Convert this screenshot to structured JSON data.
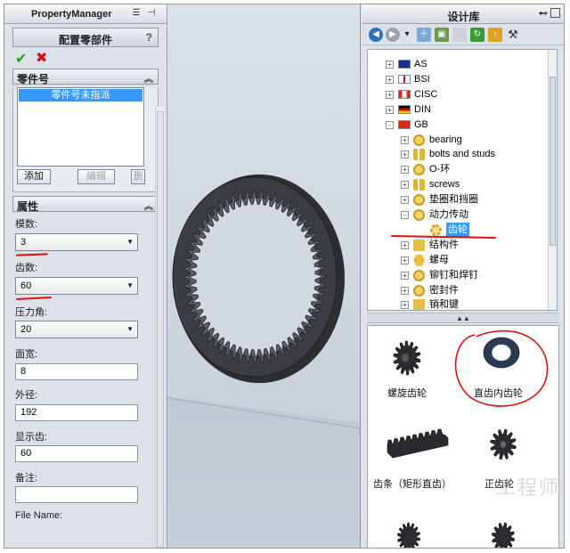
{
  "property_manager": {
    "title": "PropertyManager",
    "header": "配置零部件",
    "help": "?",
    "part_number_group": {
      "title": "零件号",
      "selected_item": "零件号未指派",
      "add_button": "添加",
      "edit_button": "编辑",
      "delete_button": "删"
    },
    "properties_group": {
      "title": "属性",
      "module_label": "模数:",
      "module_value": "3",
      "teeth_label": "齿数:",
      "teeth_value": "60",
      "pressure_angle_label": "压力角:",
      "pressure_angle_value": "20",
      "face_width_label": "面宽:",
      "face_width_value": "8",
      "outer_dia_label": "外径:",
      "outer_dia_value": "192",
      "display_teeth_label": "显示齿:",
      "display_teeth_value": "60",
      "notes_label": "备注:",
      "notes_value": "",
      "file_name_label": "File Name:"
    }
  },
  "design_library": {
    "title": "设计库",
    "tree": [
      {
        "label": "AS",
        "level": 1,
        "expander": "+",
        "icon": "australia-flag-icon"
      },
      {
        "label": "BSI",
        "level": 1,
        "expander": "+",
        "icon": "uk-flag-icon"
      },
      {
        "label": "CISC",
        "level": 1,
        "expander": "+",
        "icon": "canada-flag-icon"
      },
      {
        "label": "DIN",
        "level": 1,
        "expander": "+",
        "icon": "germany-flag-icon"
      },
      {
        "label": "GB",
        "level": 1,
        "expander": "-",
        "icon": "china-flag-icon"
      },
      {
        "label": "bearing",
        "level": 2,
        "expander": "+",
        "icon": "bearing-icon"
      },
      {
        "label": "bolts and studs",
        "level": 2,
        "expander": "+",
        "icon": "bolt-icon"
      },
      {
        "label": "O-环",
        "level": 2,
        "expander": "+",
        "icon": "o-ring-icon"
      },
      {
        "label": "screws",
        "level": 2,
        "expander": "+",
        "icon": "screw-icon"
      },
      {
        "label": "垫圈和挡圈",
        "level": 2,
        "expander": "+",
        "icon": "washer-icon"
      },
      {
        "label": "动力传动",
        "level": 2,
        "expander": "-",
        "icon": "power-transmission-icon"
      },
      {
        "label": "齿轮",
        "level": 3,
        "expander": "",
        "icon": "gear-icon",
        "selected": true
      },
      {
        "label": "结构件",
        "level": 2,
        "expander": "+",
        "icon": "structure-icon"
      },
      {
        "label": "螺母",
        "level": 2,
        "expander": "+",
        "icon": "nut-icon"
      },
      {
        "label": "铆钉和焊钉",
        "level": 2,
        "expander": "+",
        "icon": "rivet-icon"
      },
      {
        "label": "密封件",
        "level": 2,
        "expander": "+",
        "icon": "seal-icon"
      },
      {
        "label": "销和键",
        "level": 2,
        "expander": "+",
        "icon": "pin-key-icon"
      }
    ],
    "thumbnails": [
      {
        "label": "螺旋齿轮"
      },
      {
        "label": "直齿内齿轮"
      },
      {
        "label": "齿条（矩形直齿）"
      },
      {
        "label": "正齿轮"
      }
    ]
  },
  "watermark": "工程师",
  "colors": {
    "selection": "#3399ff",
    "annotation_red": "#e01010",
    "gear": "#3b3d42"
  }
}
